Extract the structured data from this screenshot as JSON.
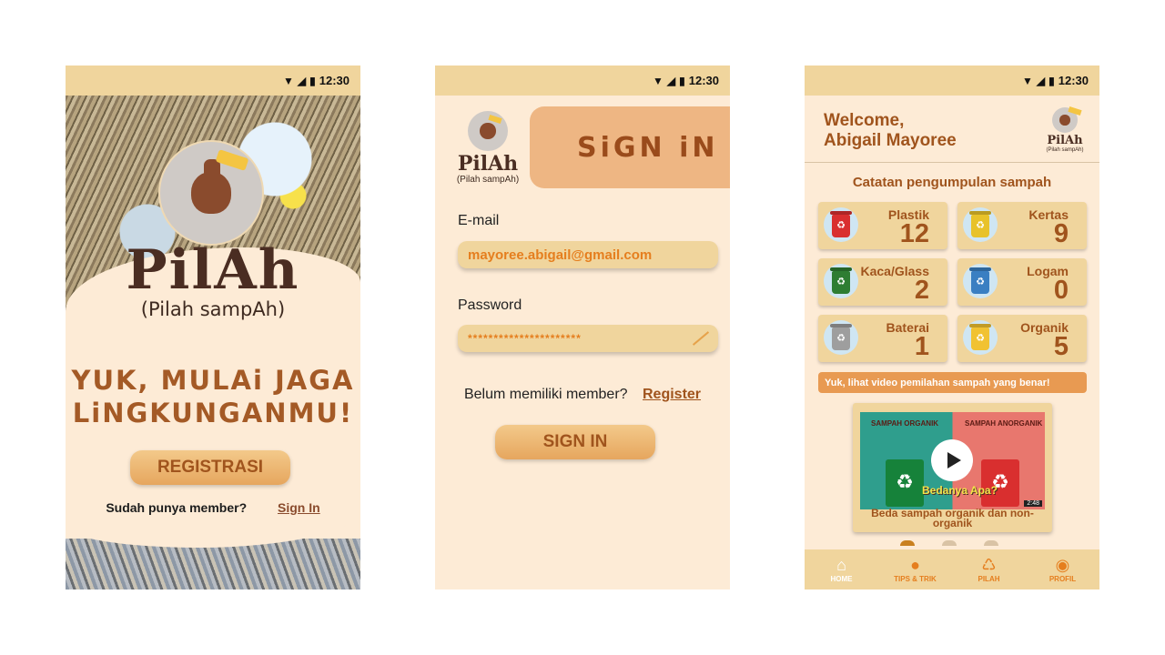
{
  "status": {
    "time": "12:30"
  },
  "icons": {
    "wifi": "wifi-icon",
    "signal": "signal-icon",
    "battery": "battery-icon",
    "eye_off": "eye-off-icon",
    "play": "play-icon"
  },
  "colors": {
    "statusbar": "#f0d59d",
    "background": "#fdebd6",
    "accent": "#a0541d",
    "orange": "#e57e1e",
    "button": "#e6a65e"
  },
  "splash": {
    "brand": "PilAh",
    "brand_sub": "(Pilah sampAh)",
    "tagline_1": "YUK, MULAi JAGA",
    "tagline_2": "LiNGKUNGANMU!",
    "register_button": "REGISTRASI",
    "member_question": "Sudah punya member?",
    "signin_link": "Sign In"
  },
  "signin": {
    "brand": "PilAh",
    "brand_sub": "(Pilah sampAh)",
    "banner": "SiGN iN",
    "email_label": "E-mail",
    "email_value": "mayoree.abigail@gmail.com",
    "password_label": "Password",
    "password_value": "**********************",
    "member_question": "Belum memiliki member?",
    "register_link": "Register",
    "signin_button": "SIGN IN"
  },
  "home": {
    "welcome_1": "Welcome,",
    "welcome_2": "Abigail Mayoree",
    "brand": "PilAh",
    "brand_sub": "(Pilah sampAh)",
    "section_title": "Catatan pengumpulan sampah",
    "categories": [
      {
        "name": "Plastik",
        "count": "12",
        "color": "#d92f2f"
      },
      {
        "name": "Kertas",
        "count": "9",
        "color": "#e8c22a"
      },
      {
        "name": "Kaca/Glass",
        "count": "2",
        "color": "#2e7d32"
      },
      {
        "name": "Logam",
        "count": "0",
        "color": "#3a7fc2"
      },
      {
        "name": "Baterai",
        "count": "1",
        "color": "#9e9e9e"
      },
      {
        "name": "Organik",
        "count": "5",
        "color": "#f1c232"
      }
    ],
    "video_banner": "Yuk, lihat video pemilahan sampah yang benar!",
    "video": {
      "header_left": "SAMPAH ORGANIK",
      "header_right": "SAMPAH ANORGANIK",
      "overlay": "Bedanya Apa?",
      "duration": "2:48",
      "title": "Beda sampah organik dan non-organik"
    },
    "nav": [
      {
        "label": "HOME",
        "icon": "home-icon"
      },
      {
        "label": "TIPS & TRIK",
        "icon": "bulb-icon"
      },
      {
        "label": "PILAH",
        "icon": "recycle-icon"
      },
      {
        "label": "PROFIL",
        "icon": "profile-icon"
      }
    ]
  }
}
